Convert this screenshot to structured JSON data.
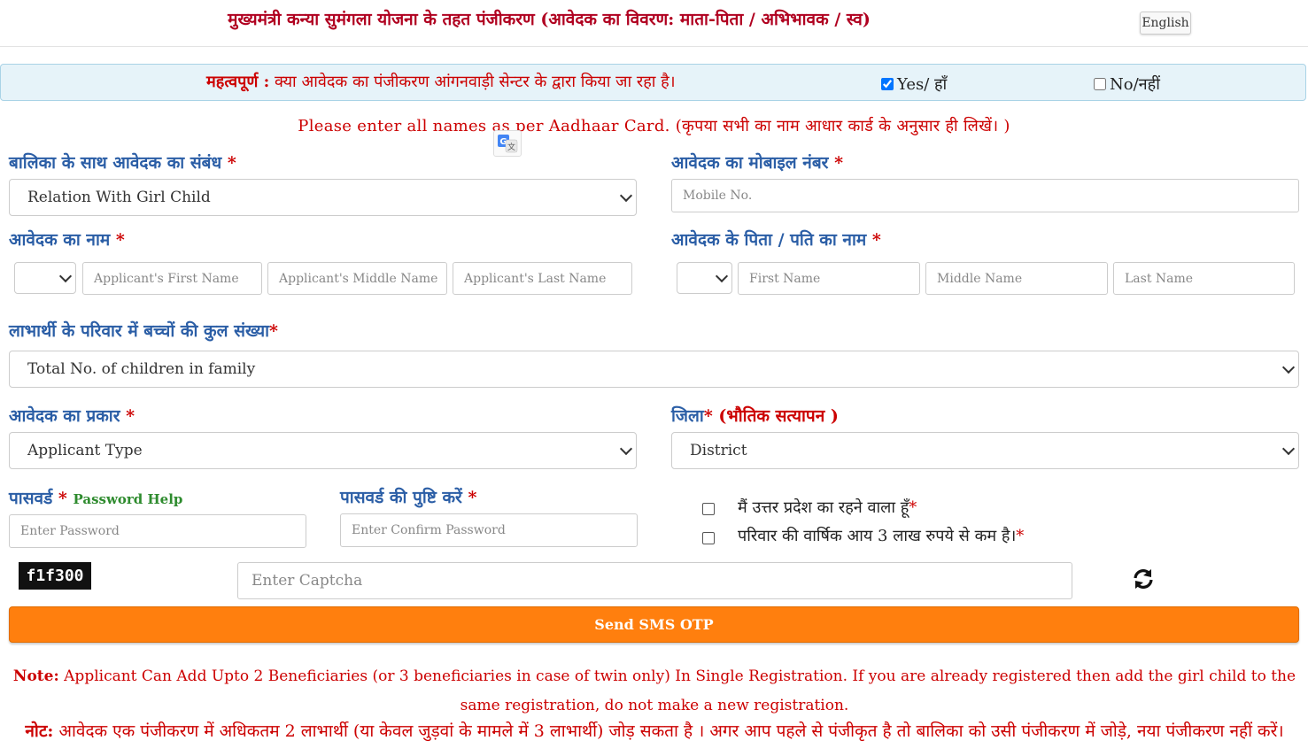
{
  "header": {
    "title": "मुख्यमंत्री कन्या सुमंगला योजना के तहत पंजीकरण (आवेदक का विवरण: माता-पिता / अभिभावक / स्व)",
    "language_button": "English"
  },
  "banner": {
    "important_label": "महत्वपूर्ण :",
    "question": "क्या आवेदक का पंजीकरण आंगनवाड़ी सेन्टर के द्वारा किया जा रहा है।",
    "yes_label": "Yes/ हाँ",
    "yes_checked": true,
    "no_label": "No/नहीं",
    "no_checked": false
  },
  "notice": "Please enter all names as per Aadhaar Card. (कृपया सभी का नाम आधार कार्ड के अनुसार ही लिखें। )",
  "relation": {
    "label": "बालिका के साथ आवेदक का संबंध",
    "required": "*",
    "selected": "Relation With Girl Child"
  },
  "mobile": {
    "label": "आवेदक का मोबाइल नंबर",
    "required": "*",
    "placeholder": "Mobile No."
  },
  "applicant_name": {
    "label": "आवेदक का नाम",
    "required": "*",
    "first_placeholder": "Applicant's First Name",
    "middle_placeholder": "Applicant's Middle Name",
    "last_placeholder": "Applicant's Last Name"
  },
  "father_name": {
    "label": "आवेदक के पिता / पति का नाम",
    "required": "*",
    "first_placeholder": "First Name",
    "middle_placeholder": "Middle Name",
    "last_placeholder": "Last Name"
  },
  "children": {
    "label": "लाभार्थी के परिवार में बच्चों की कुल संख्या",
    "required": "*",
    "selected": "Total No. of children in family"
  },
  "applicant_type": {
    "label": "आवेदक का प्रकार",
    "required": "*",
    "selected": "Applicant Type"
  },
  "district": {
    "label": "जिला",
    "required": "*",
    "note": "(भौतिक सत्यापन )",
    "selected": "District"
  },
  "password": {
    "label": "पासवर्ड",
    "required": "*",
    "help": "Password Help",
    "placeholder": "Enter Password"
  },
  "confirm_password": {
    "label": "पासवर्ड की पुष्टि करें",
    "required": "*",
    "placeholder": "Enter Confirm Password"
  },
  "declarations": [
    {
      "text": "मैं उत्तर प्रदेश का रहने वाला हूँ",
      "required": "*"
    },
    {
      "text": "परिवार की वार्षिक आय 3 लाख रुपये से कम है।",
      "required": "*"
    }
  ],
  "captcha": {
    "code": "f1f300",
    "placeholder": "Enter Captcha"
  },
  "otp_button": "Send SMS OTP",
  "note_en": {
    "label": "Note:",
    "text": "Applicant Can Add Upto 2 Beneficiaries (or 3 beneficiaries in case of twin only) In Single Registration. If you are already registered then add the girl child to the same registration, do not make a new registration."
  },
  "note_hi": {
    "label": "नोट:",
    "text": "आवेदक एक पंजीकरण में अधिकतम 2 लाभार्थी (या केवल जुड़वां के मामले में 3 लाभार्थी) जोड़ सकता है । अगर आप पहले से पंजीकृत है तो बालिका को उसी पंजीकरण में जोड़े, नया पंजीकरण नहीं करें।"
  }
}
